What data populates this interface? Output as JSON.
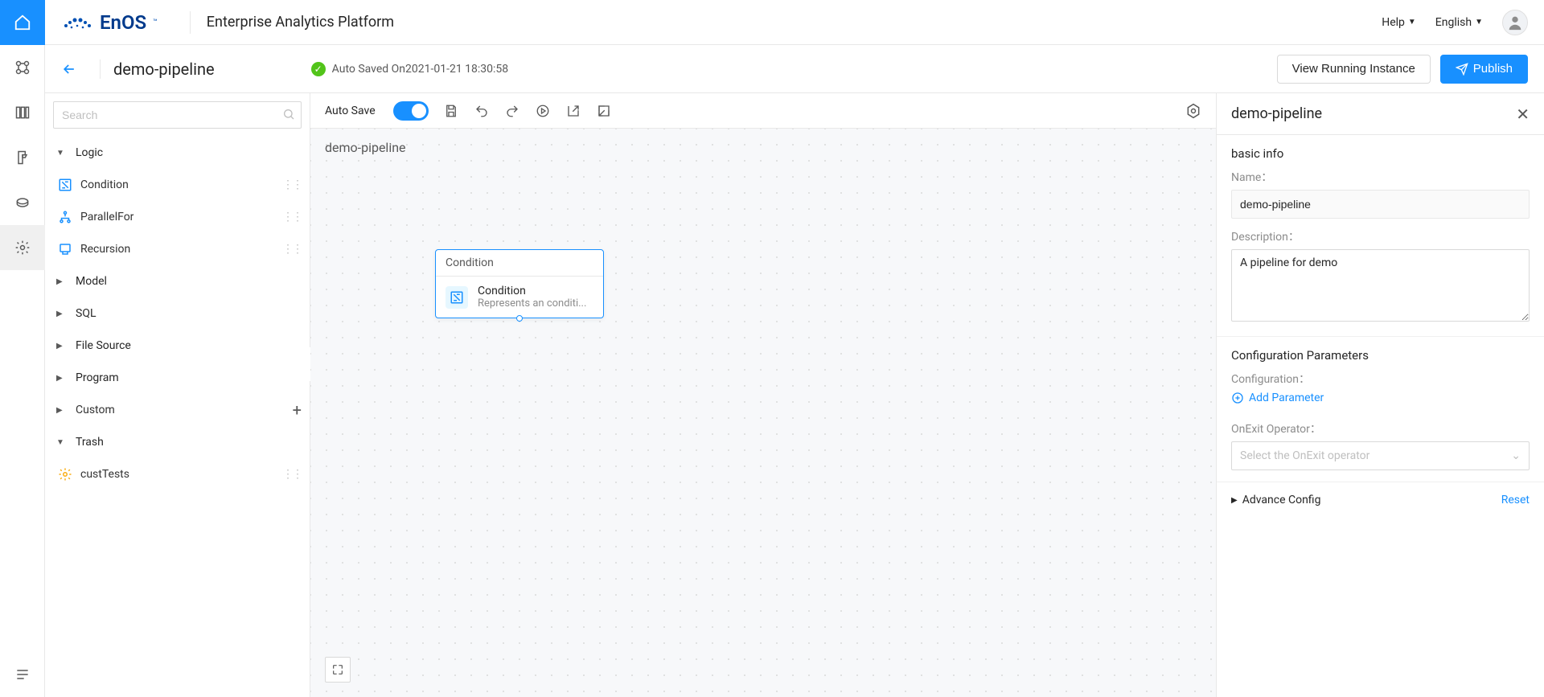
{
  "header": {
    "logo": "EnOS",
    "title": "Enterprise Analytics Platform",
    "help": "Help",
    "language": "English"
  },
  "subheader": {
    "pipeline_name": "demo-pipeline",
    "auto_saved": "Auto Saved On2021-01-21 18:30:58",
    "view_instance": "View Running Instance",
    "publish": "Publish"
  },
  "left_panel": {
    "search_placeholder": "Search",
    "groups": {
      "logic": "Logic",
      "model": "Model",
      "sql": "SQL",
      "file_source": "File Source",
      "program": "Program",
      "custom": "Custom",
      "trash": "Trash"
    },
    "logic_items": {
      "condition": "Condition",
      "parallelfor": "ParallelFor",
      "recursion": "Recursion"
    },
    "trash_items": {
      "custtests": "custTests"
    }
  },
  "toolbar": {
    "auto_save": "Auto Save"
  },
  "canvas": {
    "title": "demo-pipeline",
    "node": {
      "head": "Condition",
      "title": "Condition",
      "desc": "Represents an conditi..."
    }
  },
  "right_panel": {
    "title": "demo-pipeline",
    "basic_info": "basic info",
    "name_label": "Name：",
    "name_value": "demo-pipeline",
    "desc_label": "Description：",
    "desc_value": "A pipeline for demo",
    "config_params": "Configuration Parameters",
    "config_label": "Configuration：",
    "add_param": "Add Parameter",
    "onexit_label": "OnExit Operator：",
    "onexit_placeholder": "Select the OnExit operator",
    "advance": "Advance Config",
    "reset": "Reset"
  }
}
